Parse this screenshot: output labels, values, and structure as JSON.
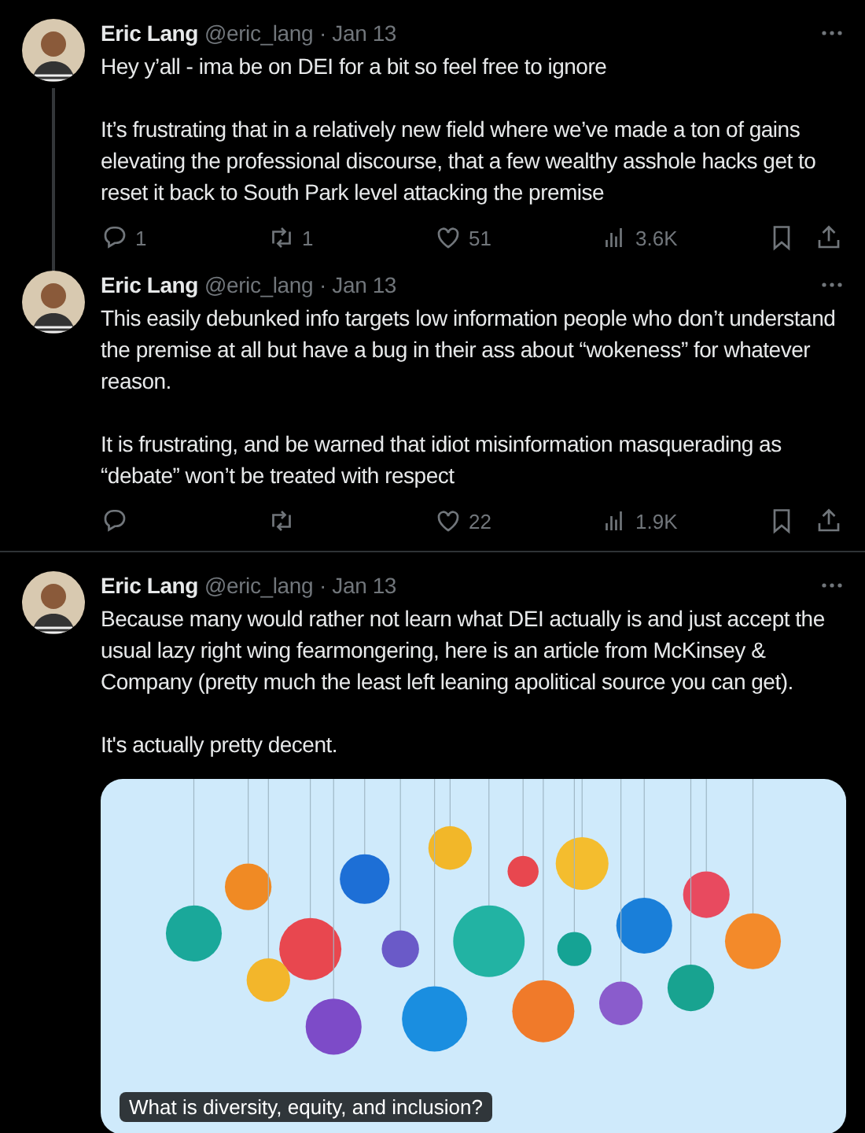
{
  "tweets": [
    {
      "name": "Eric Lang",
      "handle": "@eric_lang",
      "date": "· Jan 13",
      "thread_continues": true,
      "paragraphs": [
        "Hey y’all - ima be on DEI for a bit so feel free to ignore",
        "It’s frustrating that in a relatively new field where we’ve made a ton of gains elevating the professional discourse, that a few wealthy asshole hacks get to reset it back to South Park level attacking the premise"
      ],
      "actions": [
        {
          "kind": "reply",
          "count": "1"
        },
        {
          "kind": "repost",
          "count": "1"
        },
        {
          "kind": "like",
          "count": "51"
        },
        {
          "kind": "views",
          "count": "3.6K"
        }
      ]
    },
    {
      "name": "Eric Lang",
      "handle": "@eric_lang",
      "date": "· Jan 13",
      "thread_continues": false,
      "paragraphs": [
        "This easily debunked info targets low information people who don’t understand the premise at all but have a bug in their ass about “wokeness” for whatever reason.",
        "It is frustrating, and be warned that idiot misinformation masquerading as “debate” won’t be treated with respect"
      ],
      "actions": [
        {
          "kind": "reply"
        },
        {
          "kind": "repost"
        },
        {
          "kind": "like",
          "count": "22"
        },
        {
          "kind": "views",
          "count": "1.9K"
        }
      ]
    },
    {
      "name": "Eric Lang",
      "handle": "@eric_lang",
      "date": "· Jan 13",
      "thread_continues": false,
      "paragraphs": [
        "Because many would rather not learn what DEI actually is and just accept the usual lazy right wing fearmongering, here is an article from McKinsey & Company (pretty much the least left leaning apolitical source you can get).",
        "It's actually pretty decent."
      ],
      "card": {
        "kind": "picture",
        "caption": "What is diversity, equity, and inclusion?"
      }
    }
  ]
}
